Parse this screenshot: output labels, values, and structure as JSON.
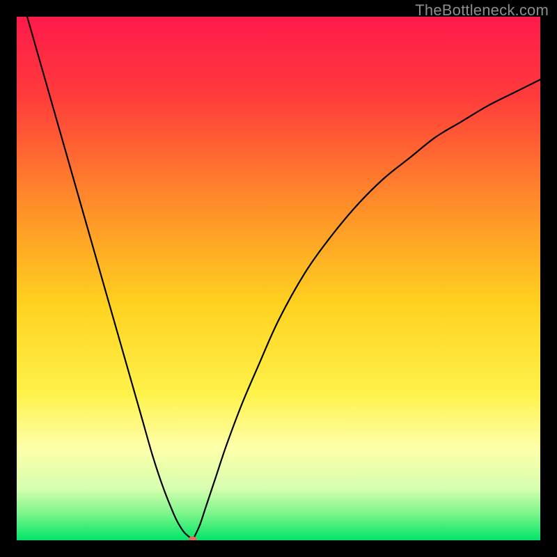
{
  "watermark": "TheBottleneck.com",
  "chart_data": {
    "type": "line",
    "title": "",
    "xlabel": "",
    "ylabel": "",
    "xlim": [
      0,
      100
    ],
    "ylim": [
      0,
      100
    ],
    "grid": false,
    "legend": false,
    "background_gradient": {
      "stops": [
        {
          "offset": 0.0,
          "color": "#ff1a4b"
        },
        {
          "offset": 0.15,
          "color": "#ff3b3b"
        },
        {
          "offset": 0.35,
          "color": "#ff8a2a"
        },
        {
          "offset": 0.55,
          "color": "#ffd21f"
        },
        {
          "offset": 0.72,
          "color": "#fff24a"
        },
        {
          "offset": 0.82,
          "color": "#ffffa8"
        },
        {
          "offset": 0.9,
          "color": "#d8ffb0"
        },
        {
          "offset": 0.95,
          "color": "#7af58a"
        },
        {
          "offset": 1.0,
          "color": "#00e56a"
        }
      ]
    },
    "series": [
      {
        "name": "curve",
        "color": "#000000",
        "x": [
          2,
          4,
          6,
          8,
          10,
          12,
          14,
          16,
          18,
          20,
          22,
          24,
          26,
          28,
          30,
          31,
          32,
          33,
          33.6,
          34,
          35,
          36,
          38,
          40,
          43,
          46,
          50,
          55,
          60,
          65,
          70,
          75,
          80,
          85,
          90,
          95,
          100
        ],
        "y": [
          100,
          93,
          86,
          79,
          72,
          65,
          58,
          51,
          44,
          37,
          30,
          23,
          16,
          10,
          5,
          3,
          1.5,
          0.6,
          0.2,
          0.8,
          3,
          6,
          12,
          18,
          26,
          33,
          42,
          51,
          58,
          64,
          69,
          73,
          77,
          80,
          83,
          85.5,
          88
        ]
      }
    ],
    "marker": {
      "name": "min-marker",
      "x": 33.6,
      "y": 0.2,
      "color": "#e26b5d",
      "rx": 6,
      "ry": 4
    }
  }
}
